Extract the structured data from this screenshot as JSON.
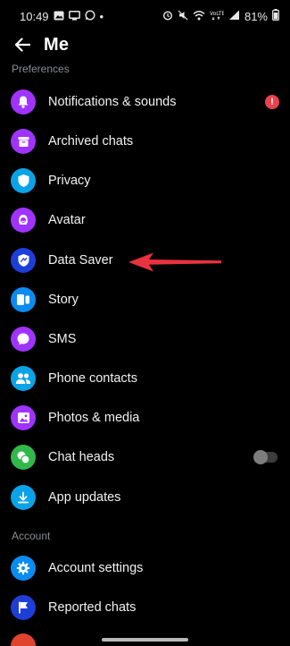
{
  "status_bar": {
    "time": "10:49",
    "dot": "•",
    "battery": "81%",
    "left_icons": [
      "gallery-icon",
      "screen-icon",
      "whatsapp-icon"
    ],
    "right_icons": [
      "alarm-icon",
      "mute-icon",
      "wifi-icon",
      "lte-icon",
      "signal-icon",
      "battery-icon"
    ]
  },
  "header": {
    "title": "Me",
    "back_icon": "arrow-left-icon"
  },
  "sections": {
    "preferences": "Preferences",
    "account": "Account"
  },
  "preferences_items": [
    {
      "label": "Notifications & sounds",
      "icon": "bell-icon",
      "color": "#a033ff"
    },
    {
      "label": "Archived chats",
      "icon": "archive-box-icon",
      "color": "#a033ff"
    },
    {
      "label": "Privacy",
      "icon": "shield-icon",
      "color": "#0aa3e8"
    },
    {
      "label": "Avatar",
      "icon": "avatar-icon",
      "color": "#a033ff"
    },
    {
      "label": "Data Saver",
      "icon": "data-saver-shield-icon",
      "color": "#1e3ed8"
    },
    {
      "label": "Story",
      "icon": "story-icon",
      "color": "#0a8cf0"
    },
    {
      "label": "SMS",
      "icon": "chat-bubble-icon",
      "color": "#a033ff"
    },
    {
      "label": "Phone contacts",
      "icon": "people-icon",
      "color": "#0aa3e8"
    },
    {
      "label": "Photos & media",
      "icon": "photo-icon",
      "color": "#a033ff"
    },
    {
      "label": "Chat heads",
      "icon": "chat-heads-icon",
      "color": "#31b84a"
    },
    {
      "label": "App updates",
      "icon": "download-icon",
      "color": "#0aa3e8"
    }
  ],
  "account_items": [
    {
      "label": "Account settings",
      "icon": "gear-icon",
      "color": "#0a8cf0"
    },
    {
      "label": "Reported chats",
      "icon": "flag-icon",
      "color": "#1e3ed8"
    }
  ],
  "notification_badge": "!",
  "chat_heads_enabled": false,
  "colors": {
    "background": "#000000",
    "section_header": "#8a8d91",
    "badge": "#e9424f",
    "annotation_arrow": "#e8333f"
  }
}
